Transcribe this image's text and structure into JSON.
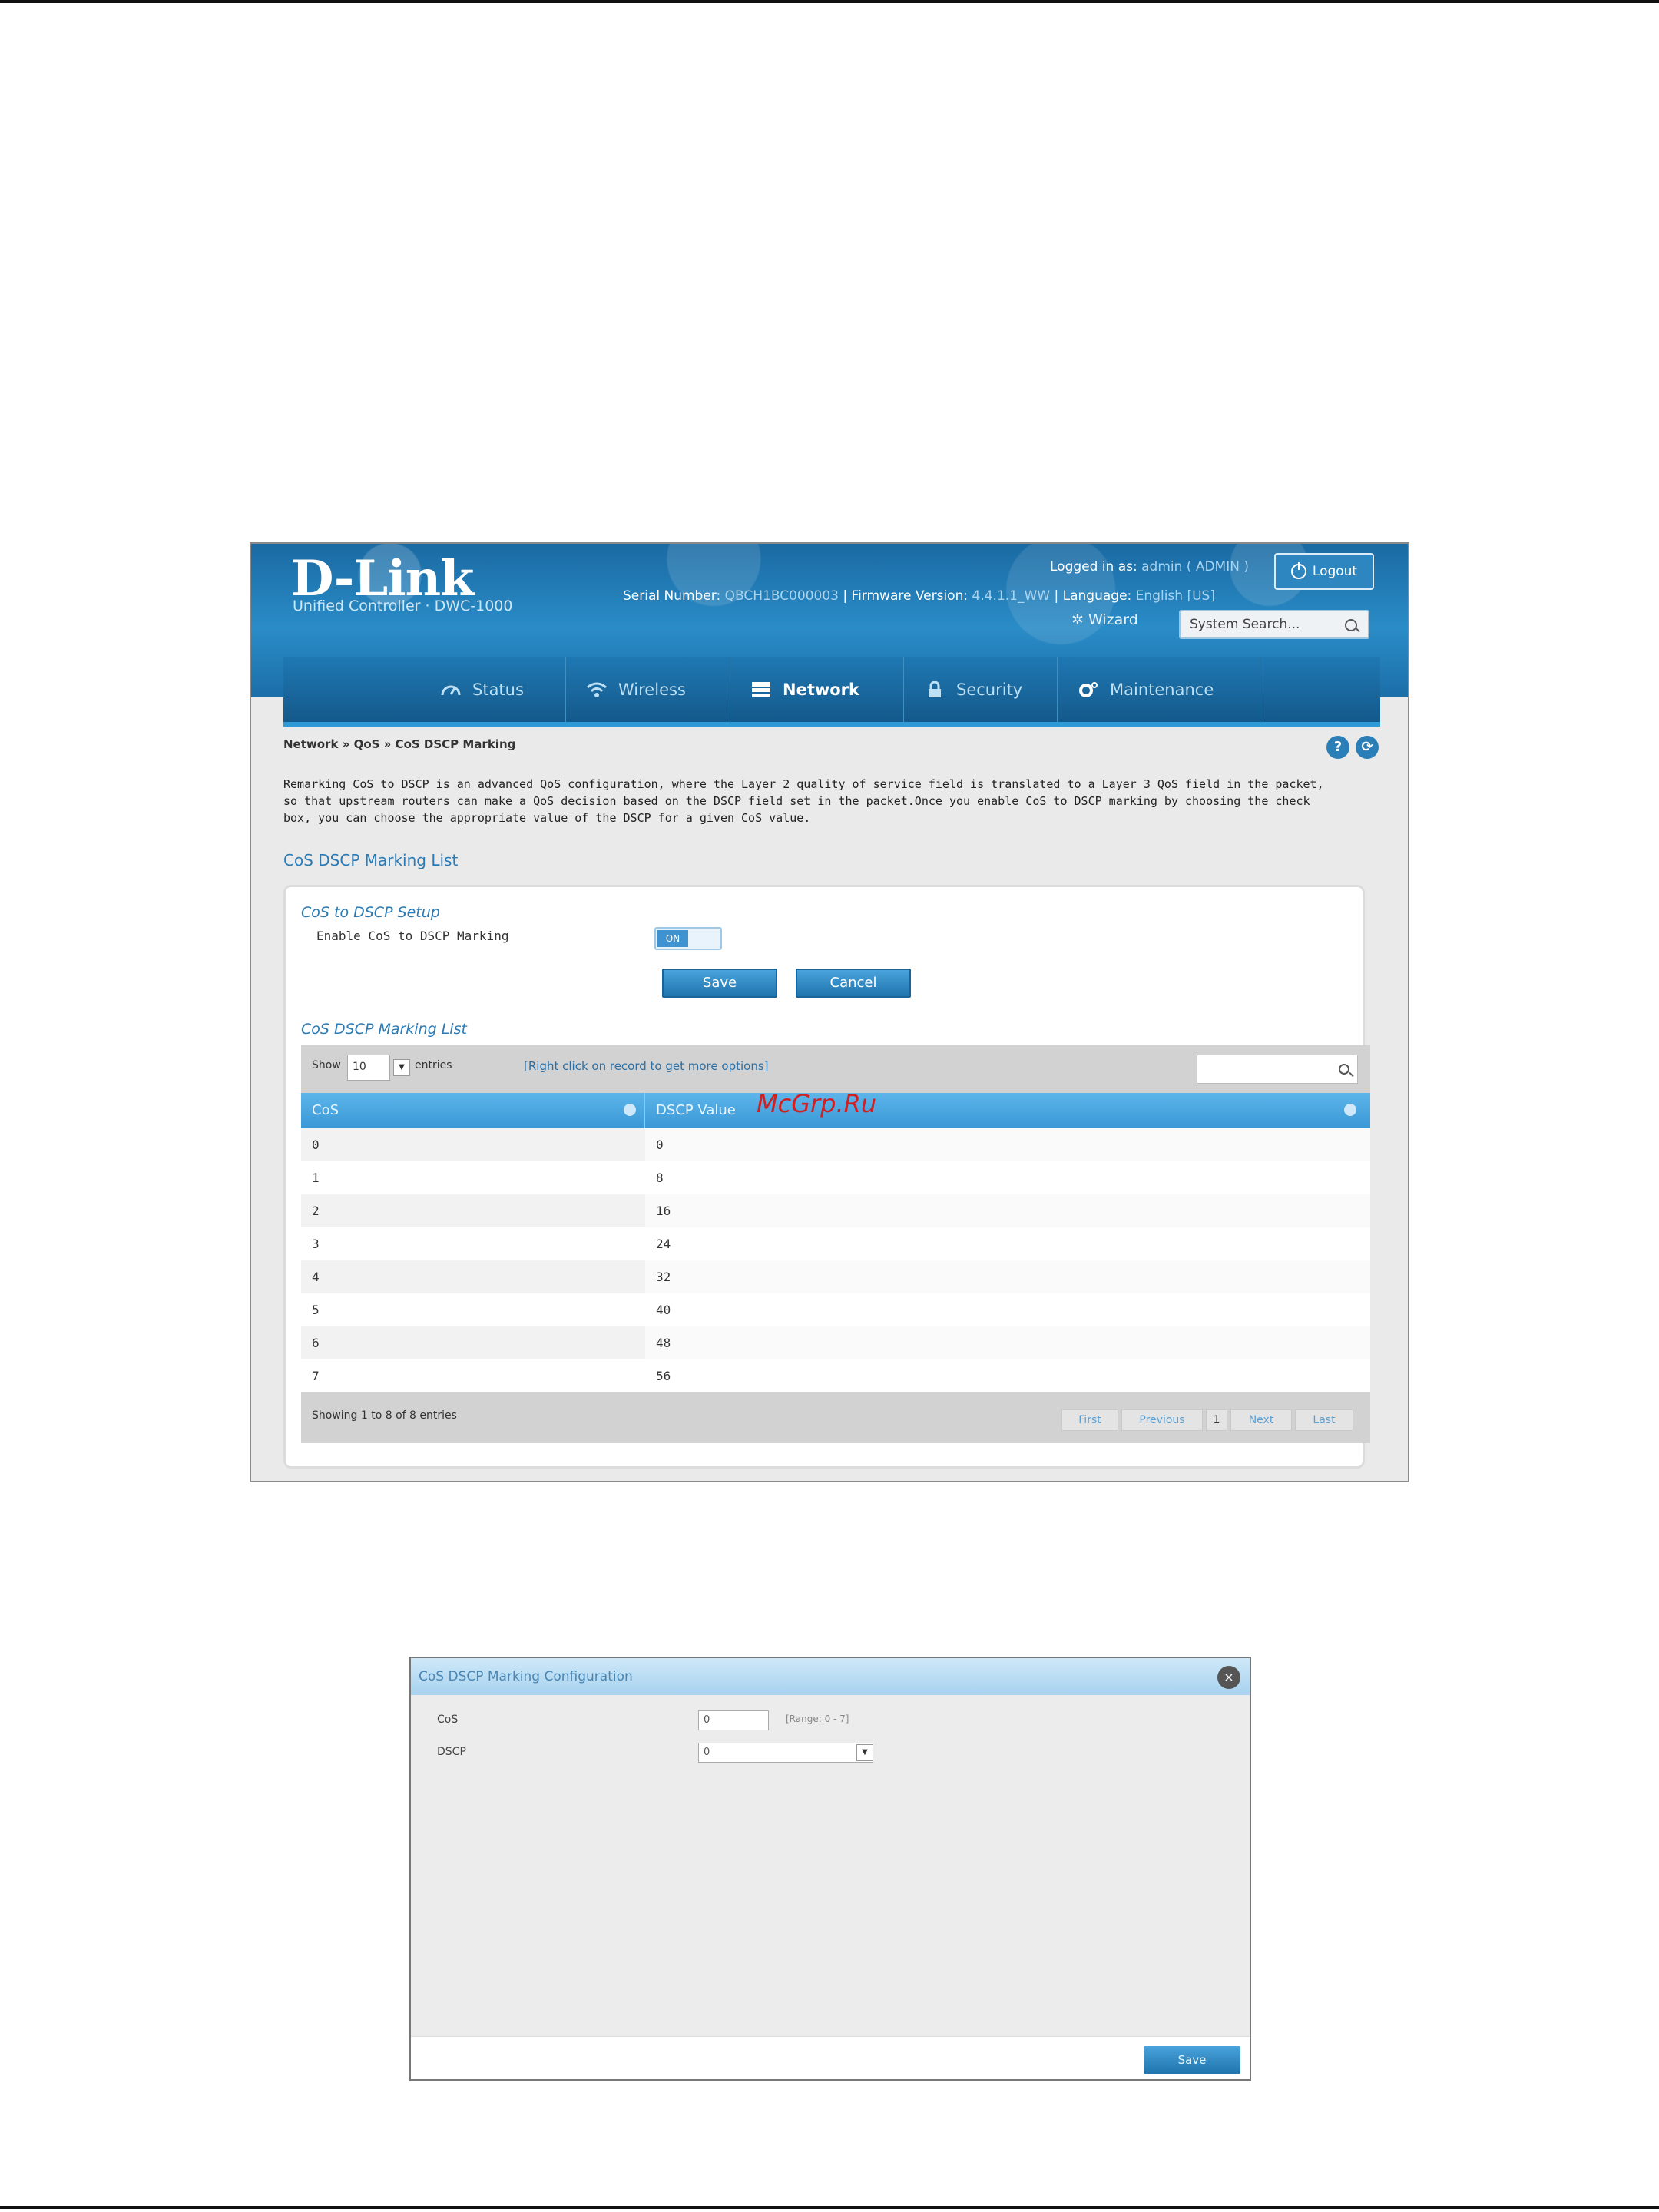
{
  "header": {
    "brand": "D-Link",
    "subbrand": "Unified Controller · DWC-1000",
    "serial_label": "Serial Number:",
    "serial_value": "QBCH1BC000003",
    "firmware_label": "Firmware Version:",
    "firmware_value": "4.4.1.1_WW",
    "logged_in_label": "Logged in as:",
    "logged_in_value": "admin ( ADMIN )",
    "language_label": "Language:",
    "language_value": "English [US]",
    "logout_label": "Logout",
    "wizard_label": "Wizard",
    "search_placeholder": "System Search..."
  },
  "nav": {
    "items": [
      {
        "label": "Status",
        "icon": "dashboard-icon"
      },
      {
        "label": "Wireless",
        "icon": "wifi-icon"
      },
      {
        "label": "Network",
        "icon": "network-icon"
      },
      {
        "label": "Security",
        "icon": "lock-icon"
      },
      {
        "label": "Maintenance",
        "icon": "gear-icon"
      }
    ],
    "active": "Network"
  },
  "breadcrumb": "Network » QoS » CoS DSCP Marking",
  "intro": "Remarking CoS to DSCP is an advanced QoS configuration, where the Layer 2 quality of service field is translated to a Layer 3 QoS field in the packet, so that upstream routers can make a QoS decision based on the DSCP field set in the packet.Once you enable CoS to DSCP marking by choosing the check box, you can choose the appropriate value of the DSCP for a given CoS value.",
  "page_title": "CoS DSCP Marking List",
  "setup": {
    "title": "CoS to DSCP Setup",
    "enable_label": "Enable CoS to DSCP Marking",
    "toggle_value": "ON",
    "save_label": "Save",
    "cancel_label": "Cancel"
  },
  "grid": {
    "title": "CoS DSCP Marking List",
    "show_label": "Show",
    "show_value": "10",
    "entries_label": "entries",
    "hint": "[Right click on record to get more options]",
    "columns": [
      "CoS",
      "DSCP Value"
    ],
    "rows": [
      [
        "0",
        "0"
      ],
      [
        "1",
        "8"
      ],
      [
        "2",
        "16"
      ],
      [
        "3",
        "24"
      ],
      [
        "4",
        "32"
      ],
      [
        "5",
        "40"
      ],
      [
        "6",
        "48"
      ],
      [
        "7",
        "56"
      ]
    ],
    "footer": "Showing 1 to 8 of 8 entries",
    "pager": {
      "first": "First",
      "previous": "Previous",
      "page": "1",
      "next": "Next",
      "last": "Last"
    }
  },
  "watermark": "McGrp.Ru",
  "dialog": {
    "title": "CoS DSCP Marking Configuration",
    "cos_label": "CoS",
    "cos_value": "0",
    "cos_range": "[Range: 0 - 7]",
    "dscp_label": "DSCP",
    "dscp_value": "0",
    "save_label": "Save"
  },
  "colors": {
    "header_blue": "#1b6ea8",
    "accent_blue": "#2a7ab5",
    "grid_header": "#3a98d6",
    "watermark_red": "#d22020"
  }
}
